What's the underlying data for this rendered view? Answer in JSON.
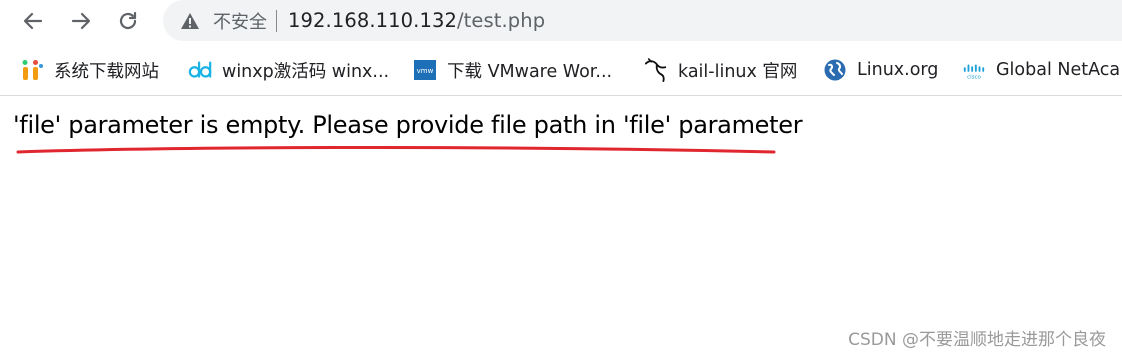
{
  "address_bar": {
    "security_label": "不安全",
    "url_host": "192.168.110.132",
    "url_path": "/test.php"
  },
  "bookmarks": [
    {
      "label": "系统下载网站",
      "icon": "system-download-site-icon"
    },
    {
      "label": "winxp激活码 winx...",
      "icon": "dd-icon"
    },
    {
      "label": "下载 VMware Wor...",
      "icon": "vmware-icon"
    },
    {
      "label": "kail-linux 官网",
      "icon": "kali-dragon-icon"
    },
    {
      "label": "Linux.org",
      "icon": "linux-org-globe-icon"
    },
    {
      "label": "Global NetAca",
      "icon": "cisco-icon"
    }
  ],
  "page": {
    "message": "'file' parameter is empty. Please provide file path in 'file' parameter"
  },
  "watermark": "CSDN @不要温顺地走进那个良夜",
  "colors": {
    "annotation_underline": "#e0262e",
    "omnibox_bg": "#f1f3f4"
  }
}
